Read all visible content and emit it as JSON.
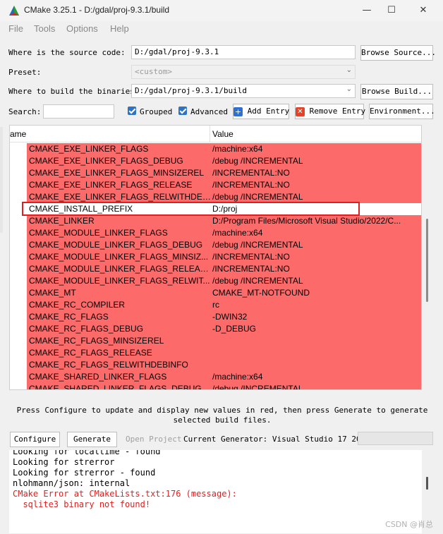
{
  "window": {
    "title": "CMake 3.25.1 - D:/gdal/proj-9.3.1/build"
  },
  "menu": [
    "File",
    "Tools",
    "Options",
    "Help"
  ],
  "source": {
    "label": "Where is the source code:",
    "value": "D:/gdal/proj-9.3.1",
    "browse_label": "Browse Source..."
  },
  "preset": {
    "label": "Preset:",
    "value": "<custom>"
  },
  "build": {
    "label": "Where to build the binaries:",
    "value": "D:/gdal/proj-9.3.1/build",
    "browse_label": "Browse Build..."
  },
  "search": {
    "label": "Search:",
    "value": ""
  },
  "toolbar": {
    "grouped_label": "Grouped",
    "grouped_checked": true,
    "advanced_label": "Advanced",
    "advanced_checked": true,
    "add_entry_label": "Add Entry",
    "remove_entry_label": "Remove Entry",
    "environment_label": "Environment..."
  },
  "table": {
    "col_name": "ame",
    "col_value": "Value",
    "rows": [
      {
        "name": "CMAKE_EXE_LINKER_FLAGS",
        "value": "/machine:x64",
        "state": "new"
      },
      {
        "name": "CMAKE_EXE_LINKER_FLAGS_DEBUG",
        "value": "/debug /INCREMENTAL",
        "state": "new"
      },
      {
        "name": "CMAKE_EXE_LINKER_FLAGS_MINSIZEREL",
        "value": "/INCREMENTAL:NO",
        "state": "new"
      },
      {
        "name": "CMAKE_EXE_LINKER_FLAGS_RELEASE",
        "value": "/INCREMENTAL:NO",
        "state": "new"
      },
      {
        "name": "CMAKE_EXE_LINKER_FLAGS_RELWITHDEB...",
        "value": "/debug /INCREMENTAL",
        "state": "new"
      },
      {
        "name": "CMAKE_INSTALL_PREFIX",
        "value": "D:/proj",
        "state": "selected"
      },
      {
        "name": "CMAKE_LINKER",
        "value": "D:/Program Files/Microsoft Visual Studio/2022/C...",
        "state": "new"
      },
      {
        "name": "CMAKE_MODULE_LINKER_FLAGS",
        "value": "/machine:x64",
        "state": "new"
      },
      {
        "name": "CMAKE_MODULE_LINKER_FLAGS_DEBUG",
        "value": "/debug /INCREMENTAL",
        "state": "new"
      },
      {
        "name": "CMAKE_MODULE_LINKER_FLAGS_MINSIZ...",
        "value": "/INCREMENTAL:NO",
        "state": "new"
      },
      {
        "name": "CMAKE_MODULE_LINKER_FLAGS_RELEASE",
        "value": "/INCREMENTAL:NO",
        "state": "new"
      },
      {
        "name": "CMAKE_MODULE_LINKER_FLAGS_RELWIT...",
        "value": "/debug /INCREMENTAL",
        "state": "new"
      },
      {
        "name": "CMAKE_MT",
        "value": "CMAKE_MT-NOTFOUND",
        "state": "new"
      },
      {
        "name": "CMAKE_RC_COMPILER",
        "value": "rc",
        "state": "new"
      },
      {
        "name": "CMAKE_RC_FLAGS",
        "value": "-DWIN32",
        "state": "new"
      },
      {
        "name": "CMAKE_RC_FLAGS_DEBUG",
        "value": "-D_DEBUG",
        "state": "new"
      },
      {
        "name": "CMAKE_RC_FLAGS_MINSIZEREL",
        "value": "",
        "state": "new"
      },
      {
        "name": "CMAKE_RC_FLAGS_RELEASE",
        "value": "",
        "state": "new"
      },
      {
        "name": "CMAKE_RC_FLAGS_RELWITHDEBINFO",
        "value": "",
        "state": "new"
      },
      {
        "name": "CMAKE_SHARED_LINKER_FLAGS",
        "value": "/machine:x64",
        "state": "new"
      },
      {
        "name": "CMAKE_SHARED_LINKER_FLAGS_DEBUG",
        "value": "/debug /INCREMENTAL",
        "state": "new"
      }
    ]
  },
  "hint": "Press Configure to update and display new values in red, then press Generate to generate selected build files.",
  "actions": {
    "configure_label": "Configure",
    "generate_label": "Generate",
    "open_project_label": "Open Project",
    "current_generator": "Current Generator: Visual Studio 17 2022"
  },
  "output": {
    "lines": [
      {
        "text": "Looking for localtime - found",
        "error": false
      },
      {
        "text": "Looking for strerror",
        "error": false
      },
      {
        "text": "Looking for strerror - found",
        "error": false
      },
      {
        "text": "nlohmann/json: internal",
        "error": false
      },
      {
        "text": "CMake Error at CMakeLists.txt:176 (message):",
        "error": true
      },
      {
        "text": "  sqlite3 binary not found!",
        "error": true
      }
    ]
  },
  "watermark": "CSDN @肖总",
  "colors": {
    "new_row": "#fd6a6a",
    "error_text": "#e02020",
    "checkbox": "#2f73c6",
    "highlight_box": "#e02020"
  }
}
